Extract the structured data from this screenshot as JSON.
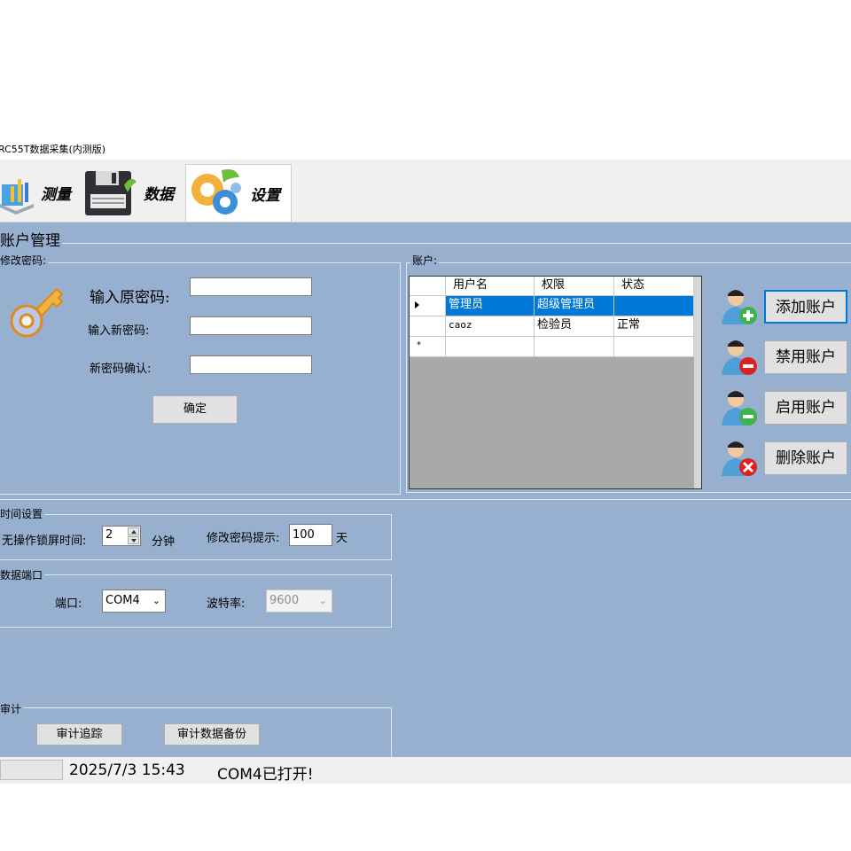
{
  "window": {
    "title": "RC55T数据采集(内测版)"
  },
  "toolbar": {
    "tabs": [
      {
        "label": "测量"
      },
      {
        "label": "数据"
      },
      {
        "label": "设置"
      }
    ]
  },
  "account_mgmt": {
    "title": "账户管理",
    "change_password": {
      "title": "修改密码:",
      "old_label": "输入原密码:",
      "new_label": "输入新密码:",
      "confirm_label": "新密码确认:",
      "old_value": "",
      "new_value": "",
      "confirm_value": "",
      "ok_button": "确定"
    },
    "accounts": {
      "title": "账户:",
      "columns": [
        "用户名",
        "权限",
        "状态"
      ],
      "rows": [
        {
          "username": "管理员",
          "permission": "超级管理员",
          "status": ""
        },
        {
          "username": "caoz",
          "permission": "检验员",
          "status": "正常"
        }
      ],
      "new_row_marker": "*"
    },
    "buttons": {
      "add": "添加账户",
      "disable": "禁用账户",
      "enable": "启用账户",
      "delete": "删除账户"
    }
  },
  "time_settings": {
    "title": "时间设置",
    "lock_label": "无操作锁屏时间:",
    "lock_value": "2",
    "lock_unit": "分钟",
    "pwd_hint_label": "修改密码提示:",
    "pwd_hint_value": "100",
    "pwd_hint_unit": "天"
  },
  "data_port": {
    "title": "数据端口",
    "port_label": "端口:",
    "port_value": "COM4",
    "baud_label": "波特率:",
    "baud_value": "9600"
  },
  "audit": {
    "title": "审计",
    "trace_button": "审计追踪",
    "backup_button": "审计数据备份"
  },
  "status": {
    "datetime": "2025/7/3 15:43",
    "message": "COM4已打开!"
  },
  "colors": {
    "panel": "#97b0cf",
    "selection": "#0078d7",
    "toolbar": "#f0f0f0"
  }
}
